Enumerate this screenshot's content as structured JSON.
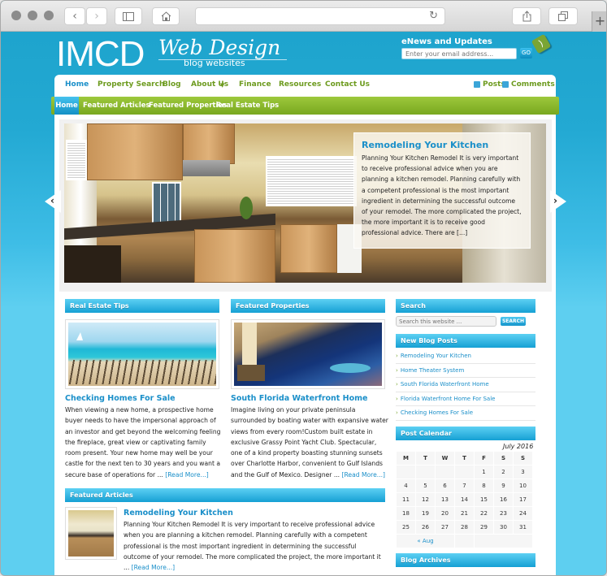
{
  "browser": {
    "back_icon": "‹",
    "forward_icon": "›",
    "sidebar_icon": "sidebar-icon",
    "home_icon": "home-icon",
    "reload_icon": "↻",
    "share_icon": "share-icon",
    "tabs_icon": "tabs-icon",
    "newtab_label": "+",
    "url": ""
  },
  "header": {
    "logo_main": "IMCD",
    "logo_script": "Web Design",
    "tagline": "blog websites",
    "enews_label": "eNews and Updates",
    "enews_placeholder": "Enter your email address...",
    "enews_button": "GO"
  },
  "topnav": {
    "items": [
      {
        "label": "Home",
        "active": true
      },
      {
        "label": "Property Search"
      },
      {
        "label": "Blog"
      },
      {
        "label": "About Us",
        "dropdown": true
      },
      {
        "label": "Finance"
      },
      {
        "label": "Resources"
      },
      {
        "label": "Contact Us"
      }
    ],
    "feeds": [
      {
        "label": "Posts"
      },
      {
        "label": "Comments"
      }
    ]
  },
  "subnav": {
    "items": [
      {
        "label": "Home",
        "active": true
      },
      {
        "label": "Featured Articles",
        "dropdown": true
      },
      {
        "label": "Featured Properties"
      },
      {
        "label": "Real Estate Tips"
      }
    ]
  },
  "slider": {
    "title": "Remodeling Your Kitchen",
    "body": "Planning Your Kitchen Remodel It is very important to receive professional advice when you are planning a kitchen remodel. Planning carefully with a competent professional is the most important ingredient in determining the successful outcome of your remodel. The more complicated the project, the more important it is to receive good professional advice. There are [...]",
    "prev_icon": "‹",
    "next_icon": "›"
  },
  "widgets": {
    "real_estate_tips": {
      "heading": "Real Estate Tips",
      "post_title": "Checking Homes For Sale",
      "excerpt": "When viewing a new home, a prospective home buyer needs to have the impersonal approach of an investor and get beyond the welcoming feeling the fireplace, great view or captivating family room present. Your new home may well be your castle for the next ten to 30 years and you want a secure base of operations for ... ",
      "read_more": "[Read More...]"
    },
    "featured_properties": {
      "heading": "Featured Properties",
      "post_title": "South Florida Waterfront Home",
      "excerpt": "Imagine living on your private peninsula surrounded by boating water with expansive water views from every room!Custom built estate in exclusive Grassy Point Yacht Club. Spectacular, one of a kind property boasting stunning sunsets over Charlotte Harbor, convenient to Gulf Islands and the Gulf of Mexico. Designer ... ",
      "read_more": "[Read More...]"
    },
    "featured_articles": {
      "heading": "Featured Articles",
      "post_title": "Remodeling Your Kitchen",
      "excerpt": "Planning Your Kitchen Remodel It is very important to receive professional advice when you are planning a kitchen remodel. Planning carefully with a competent professional is the most important ingredient in determining the successful outcome of your remodel. The more complicated the project, the more important it ... ",
      "read_more": "[Read More...]"
    }
  },
  "sidebar": {
    "search_heading": "Search",
    "search_placeholder": "Search this website ...",
    "search_button": "SEARCH",
    "blog_posts_heading": "New Blog Posts",
    "blog_posts": [
      "Remodeling Your Kitchen",
      "Home Theater System",
      "South Florida Waterfront Home",
      "Florida Waterfront Home For Sale",
      "Checking Homes For Sale"
    ],
    "calendar_heading": "Post Calendar",
    "calendar_month": "July 2016",
    "calendar_days": [
      "M",
      "T",
      "W",
      "T",
      "F",
      "S",
      "S"
    ],
    "calendar_weeks": [
      [
        "",
        "",
        "",
        "",
        "1",
        "2",
        "3"
      ],
      [
        "4",
        "5",
        "6",
        "7",
        "8",
        "9",
        "10"
      ],
      [
        "11",
        "12",
        "13",
        "14",
        "15",
        "16",
        "17"
      ],
      [
        "18",
        "19",
        "20",
        "21",
        "22",
        "23",
        "24"
      ],
      [
        "25",
        "26",
        "27",
        "28",
        "29",
        "30",
        "31"
      ]
    ],
    "calendar_prev": "« Aug",
    "archives_heading": "Blog Archives"
  },
  "colors": {
    "accent_blue": "#1a8fc9",
    "nav_green": "#6d9b1f",
    "bg_blue": "#5ecff0"
  }
}
